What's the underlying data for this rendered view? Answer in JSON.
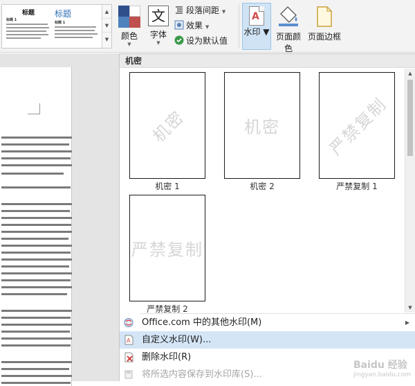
{
  "ribbon": {
    "style_gallery": {
      "thumb1_title": "标题",
      "thumb2_title": "标题",
      "thumb1_subtitle": "标题 1",
      "thumb2_subtitle": "标题 1"
    },
    "colors_label": "颜色",
    "fonts_label": "字体",
    "fonts_glyph": "文",
    "paragraph_spacing_label": "段落间距",
    "effects_label": "效果",
    "set_default_label": "设为默认值",
    "watermark_label": "水印",
    "page_color_label": "页面颜色",
    "page_border_label": "页面边框"
  },
  "watermark_menu": {
    "section_title": "机密",
    "items": [
      {
        "caption": "机密 1",
        "watermark_text": "机密",
        "orientation": "diagonal"
      },
      {
        "caption": "机密 2",
        "watermark_text": "机密",
        "orientation": "horizontal"
      },
      {
        "caption": "严禁复制 1",
        "watermark_text": "严禁复制",
        "orientation": "diagonal"
      },
      {
        "caption": "严禁复制 2",
        "watermark_text": "严禁复制",
        "orientation": "horizontal"
      }
    ],
    "commands": {
      "more_online": "Office.com 中的其他水印(M)",
      "custom": "自定义水印(W)...",
      "remove": "删除水印(R)",
      "save_selection": "将所选内容保存到水印库(S)..."
    }
  },
  "site_watermark": {
    "main": "Baidu 经验",
    "url": "jingyan.baidu.com"
  },
  "colors": {
    "accent_highlight": "#d4e5f6",
    "watermark_button_bg": "#cfe3f5",
    "ribbon_bg": "#f3f3f3"
  }
}
